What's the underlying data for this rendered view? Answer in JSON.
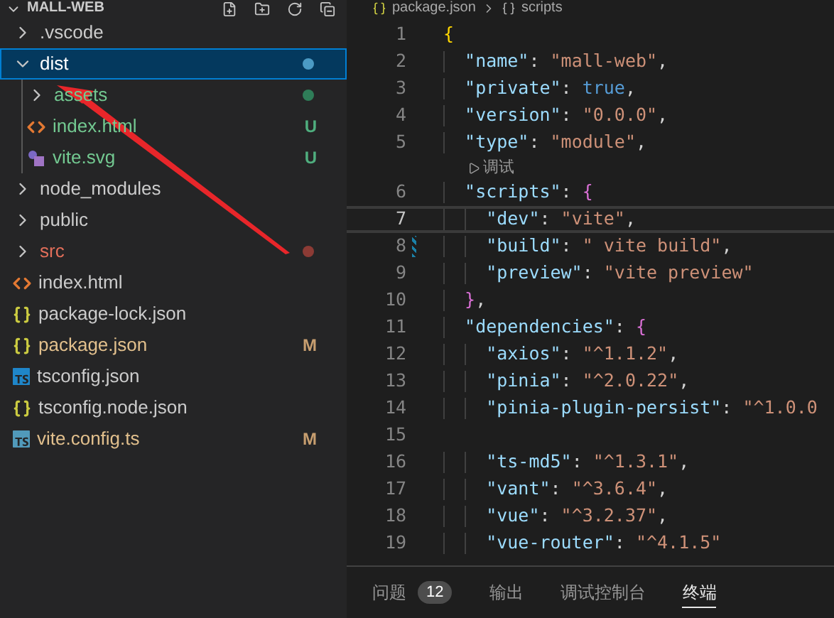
{
  "explorer": {
    "title": "MALL-WEB",
    "items": [
      {
        "name": ".vscode",
        "kind": "folder",
        "expanded": false,
        "selected": false,
        "color": "#cccccc"
      },
      {
        "name": "dist",
        "kind": "folder",
        "expanded": true,
        "selected": true,
        "color": "#ffffff",
        "status_dot": {
          "color": "#4b9ac4"
        },
        "children": [
          {
            "name": "assets",
            "kind": "folder",
            "expanded": false,
            "selected": false,
            "color": "#73c991",
            "status_dot": {
              "color": "#2f7d58"
            }
          },
          {
            "name": "index.html",
            "kind": "html",
            "selected": false,
            "color": "#73c991",
            "badge": "U"
          },
          {
            "name": "vite.svg",
            "kind": "svg",
            "selected": false,
            "color": "#73c991",
            "badge": "U"
          }
        ]
      },
      {
        "name": "node_modules",
        "kind": "folder",
        "expanded": false,
        "selected": false,
        "color": "#cccccc"
      },
      {
        "name": "public",
        "kind": "folder",
        "expanded": false,
        "selected": false,
        "color": "#cccccc"
      },
      {
        "name": "src",
        "kind": "folder",
        "expanded": false,
        "selected": false,
        "color": "#e36f5a",
        "status_dot": {
          "color": "#8c3b35"
        }
      },
      {
        "name": "index.html",
        "kind": "html",
        "selected": false,
        "color": "#cccccc"
      },
      {
        "name": "package-lock.json",
        "kind": "json",
        "selected": false,
        "color": "#cccccc"
      },
      {
        "name": "package.json",
        "kind": "json",
        "selected": false,
        "color": "#e2c08d",
        "badge": "M"
      },
      {
        "name": "tsconfig.json",
        "kind": "tsconfig",
        "selected": false,
        "color": "#cccccc"
      },
      {
        "name": "tsconfig.node.json",
        "kind": "json",
        "selected": false,
        "color": "#cccccc"
      },
      {
        "name": "vite.config.ts",
        "kind": "ts",
        "selected": false,
        "color": "#e2c08d",
        "badge": "M"
      }
    ]
  },
  "breadcrumb": [
    "package.json",
    "scripts"
  ],
  "editor": {
    "lines": [
      {
        "kind": "code",
        "number": "1",
        "current": false,
        "modified": false,
        "tokens": [
          {
            "kind": "brace",
            "text": "{"
          }
        ]
      },
      {
        "kind": "code",
        "number": "2",
        "current": false,
        "modified": false,
        "tokens": [
          {
            "kind": "key",
            "text": "  \"name\""
          },
          {
            "kind": "punct",
            "text": ": "
          },
          {
            "kind": "string",
            "text": "\"mall-web\""
          },
          {
            "kind": "punct",
            "text": ","
          }
        ]
      },
      {
        "kind": "code",
        "number": "3",
        "current": false,
        "modified": false,
        "tokens": [
          {
            "kind": "key",
            "text": "  \"private\""
          },
          {
            "kind": "punct",
            "text": ": "
          },
          {
            "kind": "keyword",
            "text": "true"
          },
          {
            "kind": "punct",
            "text": ","
          }
        ]
      },
      {
        "kind": "code",
        "number": "4",
        "current": false,
        "modified": false,
        "tokens": [
          {
            "kind": "key",
            "text": "  \"version\""
          },
          {
            "kind": "punct",
            "text": ": "
          },
          {
            "kind": "string",
            "text": "\"0.0.0\""
          },
          {
            "kind": "punct",
            "text": ","
          }
        ]
      },
      {
        "kind": "code",
        "number": "5",
        "current": false,
        "modified": false,
        "tokens": [
          {
            "kind": "key",
            "text": "  \"type\""
          },
          {
            "kind": "punct",
            "text": ": "
          },
          {
            "kind": "string",
            "text": "\"module\""
          },
          {
            "kind": "punct",
            "text": ","
          }
        ]
      },
      {
        "kind": "codelens",
        "text": "调试"
      },
      {
        "kind": "code",
        "number": "6",
        "current": false,
        "modified": false,
        "tokens": [
          {
            "kind": "key",
            "text": "  \"scripts\""
          },
          {
            "kind": "punct",
            "text": ": "
          },
          {
            "kind": "brace2",
            "text": "{"
          }
        ]
      },
      {
        "kind": "code",
        "number": "7",
        "current": true,
        "modified": false,
        "tokens": [
          {
            "kind": "key",
            "text": "    \"dev\""
          },
          {
            "kind": "punct",
            "text": ": "
          },
          {
            "kind": "string",
            "text": "\"vite\""
          },
          {
            "kind": "punct",
            "text": ","
          }
        ]
      },
      {
        "kind": "code",
        "number": "8",
        "current": false,
        "modified": true,
        "tokens": [
          {
            "kind": "key",
            "text": "    \"build\""
          },
          {
            "kind": "punct",
            "text": ": "
          },
          {
            "kind": "string",
            "text": "\" vite build\""
          },
          {
            "kind": "punct",
            "text": ","
          }
        ]
      },
      {
        "kind": "code",
        "number": "9",
        "current": false,
        "modified": false,
        "tokens": [
          {
            "kind": "key",
            "text": "    \"preview\""
          },
          {
            "kind": "punct",
            "text": ": "
          },
          {
            "kind": "string",
            "text": "\"vite preview\""
          }
        ]
      },
      {
        "kind": "code",
        "number": "10",
        "current": false,
        "modified": false,
        "tokens": [
          {
            "kind": "brace2",
            "text": "  }"
          },
          {
            "kind": "punct",
            "text": ","
          }
        ]
      },
      {
        "kind": "code",
        "number": "11",
        "current": false,
        "modified": false,
        "tokens": [
          {
            "kind": "key",
            "text": "  \"dependencies\""
          },
          {
            "kind": "punct",
            "text": ": "
          },
          {
            "kind": "brace2",
            "text": "{"
          }
        ]
      },
      {
        "kind": "code",
        "number": "12",
        "current": false,
        "modified": false,
        "tokens": [
          {
            "kind": "key",
            "text": "    \"axios\""
          },
          {
            "kind": "punct",
            "text": ": "
          },
          {
            "kind": "string",
            "text": "\"^1.1.2\""
          },
          {
            "kind": "punct",
            "text": ","
          }
        ]
      },
      {
        "kind": "code",
        "number": "13",
        "current": false,
        "modified": false,
        "tokens": [
          {
            "kind": "key",
            "text": "    \"pinia\""
          },
          {
            "kind": "punct",
            "text": ": "
          },
          {
            "kind": "string",
            "text": "\"^2.0.22\""
          },
          {
            "kind": "punct",
            "text": ","
          }
        ]
      },
      {
        "kind": "code",
        "number": "14",
        "current": false,
        "modified": false,
        "tokens": [
          {
            "kind": "key",
            "text": "    \"pinia-plugin-persist\""
          },
          {
            "kind": "punct",
            "text": ": "
          },
          {
            "kind": "string",
            "text": "\"^1.0.0"
          }
        ]
      },
      {
        "kind": "code",
        "number": "15",
        "current": false,
        "modified": false
      },
      {
        "kind": "code",
        "number": "16",
        "current": false,
        "modified": false,
        "tokens": [
          {
            "kind": "key",
            "text": "    \"ts-md5\""
          },
          {
            "kind": "punct",
            "text": ": "
          },
          {
            "kind": "string",
            "text": "\"^1.3.1\""
          },
          {
            "kind": "punct",
            "text": ","
          }
        ]
      },
      {
        "kind": "code",
        "number": "17",
        "current": false,
        "modified": false,
        "tokens": [
          {
            "kind": "key",
            "text": "    \"vant\""
          },
          {
            "kind": "punct",
            "text": ": "
          },
          {
            "kind": "string",
            "text": "\"^3.6.4\""
          },
          {
            "kind": "punct",
            "text": ","
          }
        ]
      },
      {
        "kind": "code",
        "number": "18",
        "current": false,
        "modified": false,
        "tokens": [
          {
            "kind": "key",
            "text": "    \"vue\""
          },
          {
            "kind": "punct",
            "text": ": "
          },
          {
            "kind": "string",
            "text": "\"^3.2.37\""
          },
          {
            "kind": "punct",
            "text": ","
          }
        ]
      },
      {
        "kind": "code",
        "number": "19",
        "current": false,
        "modified": false,
        "tokens": [
          {
            "kind": "key",
            "text": "    \"vue-router\""
          },
          {
            "kind": "punct",
            "text": ": "
          },
          {
            "kind": "string",
            "text": "\"^4.1.5\""
          }
        ]
      }
    ]
  },
  "panel": {
    "tabs": [
      {
        "label": "问题",
        "badge": "12",
        "selected": false
      },
      {
        "label": "输出",
        "selected": false
      },
      {
        "label": "调试控制台",
        "selected": false
      },
      {
        "label": "终端",
        "selected": true
      }
    ]
  }
}
